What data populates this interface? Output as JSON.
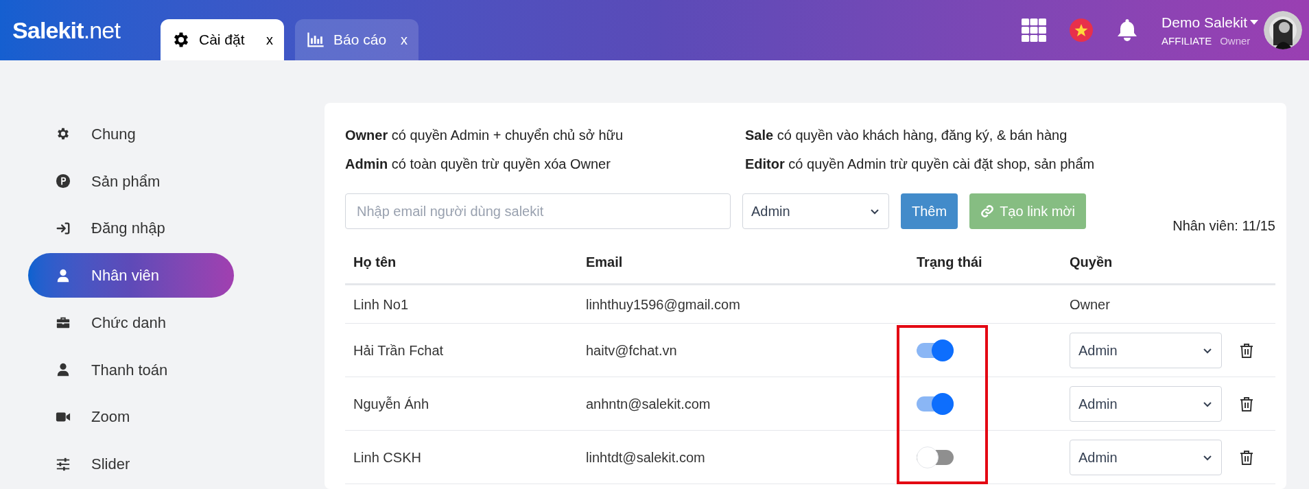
{
  "header": {
    "logo": "**Salekit**.net",
    "tabs": [
      {
        "label": "Cài đặt",
        "close": "x",
        "selected": true
      },
      {
        "label": "Báo cáo",
        "close": "x",
        "selected": false
      }
    ],
    "user": {
      "name": "Demo Salekit",
      "plan": "AFFILIATE",
      "role": "Owner"
    }
  },
  "sidebar": {
    "items": [
      {
        "label": "Chung",
        "selected": false
      },
      {
        "label": "Sản phẩm",
        "selected": false
      },
      {
        "label": "Đăng nhập",
        "selected": false
      },
      {
        "label": "Nhân viên",
        "selected": true
      },
      {
        "label": "Chức danh",
        "selected": false
      },
      {
        "label": "Thanh toán",
        "selected": false
      },
      {
        "label": "Zoom",
        "selected": false
      },
      {
        "label": "Slider",
        "selected": false
      }
    ]
  },
  "roles_info": [
    "**Owner** có quyền Admin + chuyển chủ sở hữu",
    "**Sale** có quyền vào khách hàng, đăng ký, & bán hàng",
    "**Admin** có toàn quyền trừ quyền xóa Owner",
    "**Editor** có quyền Admin trừ quyền cài đặt shop, sản phẩm"
  ],
  "invite": {
    "email_placeholder": "Nhập email người dùng salekit",
    "role": "Admin",
    "add_button": "Thêm",
    "link_button": "Tạo link mời",
    "count": "Nhân viên: 11/15"
  },
  "table": {
    "columns": [
      "Họ tên",
      "Email",
      "Trạng thái",
      "Quyền"
    ],
    "rows": [
      {
        "kind": "owner",
        "name": "Linh No1",
        "email": "linhthuy1596@gmail.com",
        "role": "Owner"
      },
      {
        "kind": "member",
        "name": "Hải Trần Fchat",
        "email": "haitv@fchat.vn",
        "on": true,
        "role": "Admin"
      },
      {
        "kind": "member",
        "name": "Nguyễn Ánh",
        "email": "anhntn@salekit.com",
        "on": true,
        "role": "Admin"
      },
      {
        "kind": "member",
        "name": "Linh CSKH",
        "email": "linhtdt@salekit.com",
        "on": false,
        "role": "Admin"
      }
    ]
  }
}
